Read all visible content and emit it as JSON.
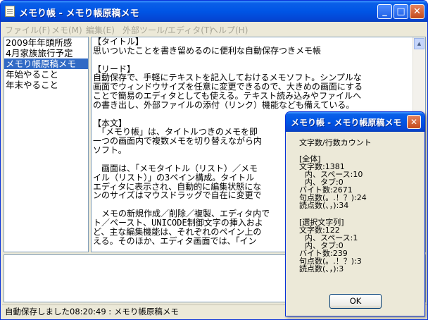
{
  "window": {
    "title": "メモり帳 - メモり帳原稿メモ",
    "minimize": "_",
    "maximize": "□",
    "close": "✕"
  },
  "menu": [
    {
      "label": "ファイル(F)"
    },
    {
      "label": "メモ(M)"
    },
    {
      "label": "編集(E)"
    },
    {
      "label": "外部ツール/エディタ(T)"
    },
    {
      "label": "ヘルプ(H)"
    }
  ],
  "memo_list": [
    {
      "label": "2009年年頭所感"
    },
    {
      "label": "4月家族旅行予定"
    },
    {
      "label": "メモり帳原稿メモ"
    },
    {
      "label": "年始やること"
    },
    {
      "label": "年末やること"
    }
  ],
  "selected_index": 2,
  "editor_text": "【タイトル】\n思いついたことを書き留めるのに便利な自動保存つきメモ帳\n\n【リード】\n自動保存で、手軽にテキストを記入しておけるメモソフト。シンプルな\n画面でウィンドウサイズを任意に変更できるので、大きめの画面にする\nことで簡易のエディタとしても使える。テキスト読み込みやファイルへ\nの書き出し、外部ファイルの添付（リンク）機能なども備えている。\n\n【本文】\n　「メモり帳」は、タイトルつきのメモを即\n一つの画面内で複数メモを切り替えながら内\nソフト。\n\n　画面は、「メモタイトル（リスト）／メモ\nイル（リスト）」の3ペイン構成。タイトル\nエディタに表示され、自動的に編集状態にな\nンのサイズはマウスドラッグで自在に変更で\n\n　メモの新規作成／削除／複製、エディタ内で\nト／ペースト、UNICODE制御文字の挿入およ\nど、主な編集機能は、それぞれのペイン上の\nえる。そのほか、エディタ画面では、「イン",
  "status_text": "自動保存しました08:20:49 : メモり帳原稿メモ",
  "dialog": {
    "title": "メモり帳 - メモり帳原稿メモ",
    "close": "✕",
    "heading": "文字数/行数カウント",
    "all_header": "[全体]",
    "all_chars": "文字数:1381",
    "all_spaces": "内、スペース:10",
    "all_tabs": "内、タブ:0",
    "all_bytes": "バイト数:2671",
    "all_periods": "句点数(。.！？):24",
    "all_commas": "読点数(、，):34",
    "sel_header": "[選択文字列]",
    "sel_chars": "文字数:122",
    "sel_spaces": "内、スペース:1",
    "sel_tabs": "内、タブ:0",
    "sel_bytes": "バイト数:239",
    "sel_periods": "句点数(。.！？):3",
    "sel_commas": "読点数(、，):3",
    "ok_label": "OK"
  }
}
